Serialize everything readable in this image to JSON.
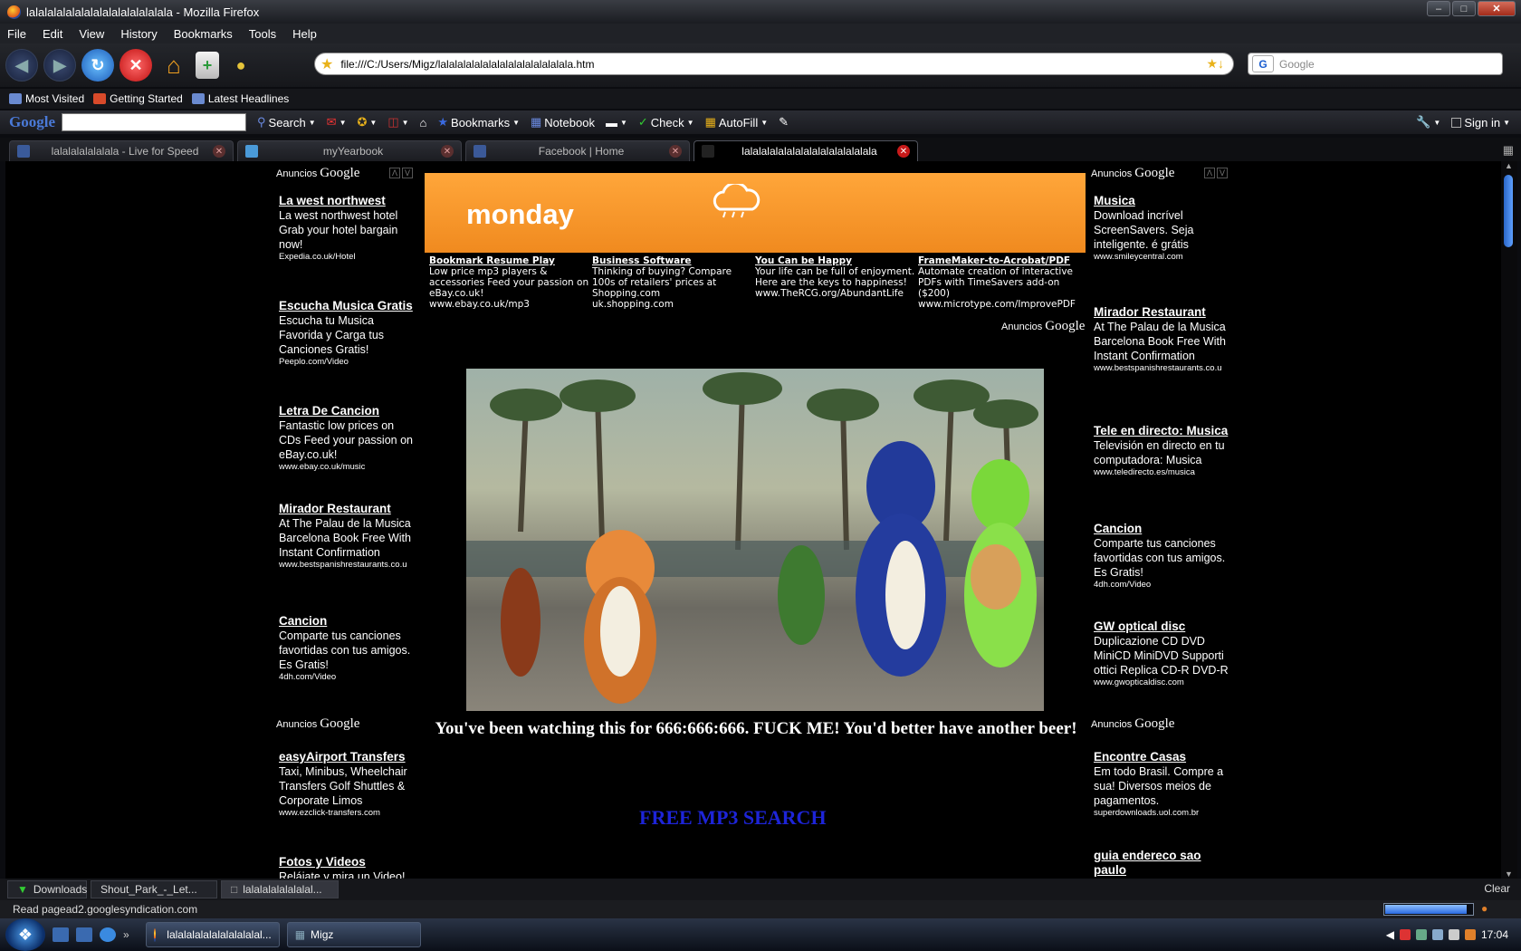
{
  "window": {
    "title": "lalalalalalalalalalalalalalalala - Mozilla Firefox"
  },
  "menu": [
    "File",
    "Edit",
    "View",
    "History",
    "Bookmarks",
    "Tools",
    "Help"
  ],
  "address": {
    "url": "file:///C:/Users/Migz/lalalalalalalalalalalalalalalala.htm"
  },
  "search": {
    "placeholder": "Google"
  },
  "bookmarks": [
    "Most Visited",
    "Getting Started",
    "Latest Headlines"
  ],
  "google_toolbar": {
    "logo": "Google",
    "search_label": "Search",
    "bookmarks_label": "Bookmarks",
    "notebook_label": "Notebook",
    "check_label": "Check",
    "autofill_label": "AutoFill",
    "signin_label": "Sign in"
  },
  "tabs": [
    {
      "label": "lalalalalalalala - Live for Speed",
      "active": false
    },
    {
      "label": "myYearbook",
      "active": false
    },
    {
      "label": "Facebook | Home",
      "active": false
    },
    {
      "label": "lalalalalalalalalalalalalalalala",
      "active": true
    }
  ],
  "ads_header": {
    "prefix": "Anuncios",
    "brand": "Google"
  },
  "left_ads": [
    {
      "title": "La west northwest",
      "text": "La west northwest hotel Grab your hotel bargain now!",
      "url": "Expedia.co.uk/Hotel"
    },
    {
      "title": "Escucha Musica Gratis",
      "text": "Escucha tu Musica Favorida y Carga tus Canciones Gratis!",
      "url": "Peeplo.com/Video"
    },
    {
      "title": "Letra De Cancion",
      "text": "Fantastic low prices on CDs Feed your passion on eBay.co.uk!",
      "url": "www.ebay.co.uk/music"
    },
    {
      "title": "Mirador Restaurant",
      "text": "At The Palau de la Musica Barcelona Book Free With Instant Confirmation",
      "url": "www.bestspanishrestaurants.co.u"
    },
    {
      "title": "Cancion",
      "text": "Comparte tus canciones favortidas con tus amigos. Es Gratis!",
      "url": "4dh.com/Video"
    }
  ],
  "left_ads_2": [
    {
      "title": "easyAirport Transfers",
      "text": "Taxi, Minibus, Wheelchair Transfers Golf Shuttles & Corporate Limos",
      "url": "www.ezclick-transfers.com"
    },
    {
      "title": "Fotos y Videos",
      "text": "Relájate y mira un Video!",
      "url": ""
    }
  ],
  "right_ads": [
    {
      "title": "Musica",
      "text": "Download incrível ScreenSavers. Seja inteligente. é grátis",
      "url": "www.smileycentral.com"
    },
    {
      "title": "Mirador Restaurant",
      "text": "At The Palau de la Musica Barcelona Book Free With Instant Confirmation",
      "url": "www.bestspanishrestaurants.co.u"
    },
    {
      "title": "Tele en directo: Musica",
      "text": "Televisión en directo en tu computadora: Musica",
      "url": "www.teledirecto.es/musica"
    },
    {
      "title": "Cancion",
      "text": "Comparte tus canciones favortidas con tus amigos. Es Gratis!",
      "url": "4dh.com/Video"
    },
    {
      "title": "GW optical disc",
      "text": "Duplicazione CD DVD MiniCD MiniDVD Supporti ottici Replica CD-R DVD-R",
      "url": "www.gwopticaldisc.com"
    }
  ],
  "right_ads_2": [
    {
      "title": "Encontre Casas",
      "text": "Em todo Brasil. Compre a sua! Diversos meios de pagamentos.",
      "url": "superdownloads.uol.com.br"
    },
    {
      "title": "guia endereco sao paulo",
      "text": "",
      "url": ""
    }
  ],
  "banner": {
    "day": "monday"
  },
  "link_units": [
    {
      "title": "Bookmark Resume Play",
      "text": "Low price mp3 players & accessories Feed your passion on eBay.co.uk!",
      "url": "www.ebay.co.uk/mp3"
    },
    {
      "title": "Business Software",
      "text": "Thinking of buying? Compare 100s of retailers' prices at Shopping.com",
      "url": "uk.shopping.com"
    },
    {
      "title": "You Can be Happy",
      "text": "Your life can be full of enjoyment. Here are the keys to happiness!",
      "url": "www.TheRCG.org/AbundantLife"
    },
    {
      "title": "FrameMaker-to-Acrobat/PDF",
      "text": "Automate creation of interactive PDFs with TimeSavers add-on ($200)",
      "url": "www.microtype.com/ImprovePDF"
    }
  ],
  "message": "You've been watching this for 666:666:666. FUCK ME! You'd better have another beer!",
  "mp3_search": "FREE MP3 SEARCH",
  "downloads": [
    {
      "label": "Downloads"
    },
    {
      "label": "Shout_Park_-_Let..."
    },
    {
      "label": "lalalalalalalalal..."
    }
  ],
  "downloads_clear": "Clear",
  "status": {
    "text": "Read pagead2.googlesyndication.com",
    "progress": 0.92
  },
  "taskbar": {
    "tasks": [
      "lalalalalalalalalalalal...",
      "Migz"
    ],
    "clock": "17:04"
  },
  "colors": {
    "banner": "#f29324",
    "mp3_link": "#1d24d8",
    "page_bg": "#000000"
  }
}
